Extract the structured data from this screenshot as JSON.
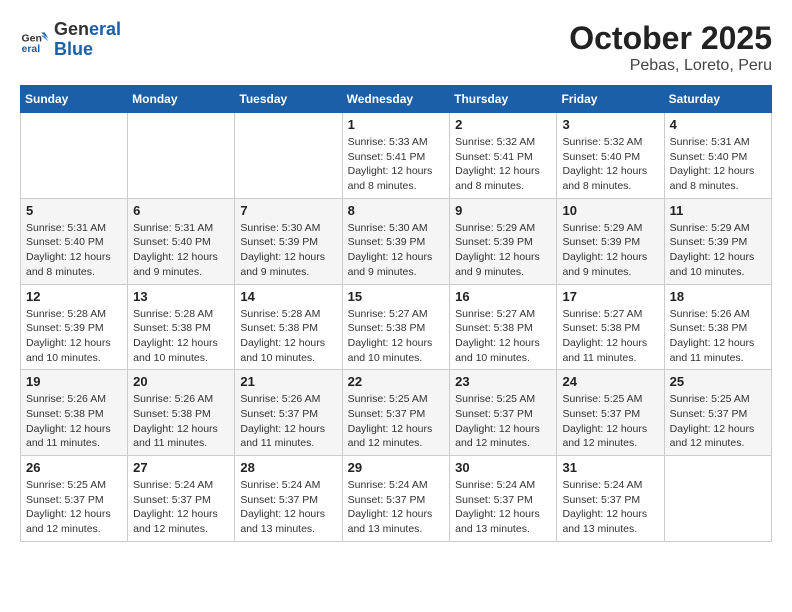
{
  "logo": {
    "line1": "General",
    "line2": "Blue"
  },
  "title": "October 2025",
  "subtitle": "Pebas, Loreto, Peru",
  "days_header": [
    "Sunday",
    "Monday",
    "Tuesday",
    "Wednesday",
    "Thursday",
    "Friday",
    "Saturday"
  ],
  "weeks": [
    [
      {
        "day": "",
        "info": ""
      },
      {
        "day": "",
        "info": ""
      },
      {
        "day": "",
        "info": ""
      },
      {
        "day": "1",
        "info": "Sunrise: 5:33 AM\nSunset: 5:41 PM\nDaylight: 12 hours and 8 minutes."
      },
      {
        "day": "2",
        "info": "Sunrise: 5:32 AM\nSunset: 5:41 PM\nDaylight: 12 hours and 8 minutes."
      },
      {
        "day": "3",
        "info": "Sunrise: 5:32 AM\nSunset: 5:40 PM\nDaylight: 12 hours and 8 minutes."
      },
      {
        "day": "4",
        "info": "Sunrise: 5:31 AM\nSunset: 5:40 PM\nDaylight: 12 hours and 8 minutes."
      }
    ],
    [
      {
        "day": "5",
        "info": "Sunrise: 5:31 AM\nSunset: 5:40 PM\nDaylight: 12 hours and 8 minutes."
      },
      {
        "day": "6",
        "info": "Sunrise: 5:31 AM\nSunset: 5:40 PM\nDaylight: 12 hours and 9 minutes."
      },
      {
        "day": "7",
        "info": "Sunrise: 5:30 AM\nSunset: 5:39 PM\nDaylight: 12 hours and 9 minutes."
      },
      {
        "day": "8",
        "info": "Sunrise: 5:30 AM\nSunset: 5:39 PM\nDaylight: 12 hours and 9 minutes."
      },
      {
        "day": "9",
        "info": "Sunrise: 5:29 AM\nSunset: 5:39 PM\nDaylight: 12 hours and 9 minutes."
      },
      {
        "day": "10",
        "info": "Sunrise: 5:29 AM\nSunset: 5:39 PM\nDaylight: 12 hours and 9 minutes."
      },
      {
        "day": "11",
        "info": "Sunrise: 5:29 AM\nSunset: 5:39 PM\nDaylight: 12 hours and 10 minutes."
      }
    ],
    [
      {
        "day": "12",
        "info": "Sunrise: 5:28 AM\nSunset: 5:39 PM\nDaylight: 12 hours and 10 minutes."
      },
      {
        "day": "13",
        "info": "Sunrise: 5:28 AM\nSunset: 5:38 PM\nDaylight: 12 hours and 10 minutes."
      },
      {
        "day": "14",
        "info": "Sunrise: 5:28 AM\nSunset: 5:38 PM\nDaylight: 12 hours and 10 minutes."
      },
      {
        "day": "15",
        "info": "Sunrise: 5:27 AM\nSunset: 5:38 PM\nDaylight: 12 hours and 10 minutes."
      },
      {
        "day": "16",
        "info": "Sunrise: 5:27 AM\nSunset: 5:38 PM\nDaylight: 12 hours and 10 minutes."
      },
      {
        "day": "17",
        "info": "Sunrise: 5:27 AM\nSunset: 5:38 PM\nDaylight: 12 hours and 11 minutes."
      },
      {
        "day": "18",
        "info": "Sunrise: 5:26 AM\nSunset: 5:38 PM\nDaylight: 12 hours and 11 minutes."
      }
    ],
    [
      {
        "day": "19",
        "info": "Sunrise: 5:26 AM\nSunset: 5:38 PM\nDaylight: 12 hours and 11 minutes."
      },
      {
        "day": "20",
        "info": "Sunrise: 5:26 AM\nSunset: 5:38 PM\nDaylight: 12 hours and 11 minutes."
      },
      {
        "day": "21",
        "info": "Sunrise: 5:26 AM\nSunset: 5:37 PM\nDaylight: 12 hours and 11 minutes."
      },
      {
        "day": "22",
        "info": "Sunrise: 5:25 AM\nSunset: 5:37 PM\nDaylight: 12 hours and 12 minutes."
      },
      {
        "day": "23",
        "info": "Sunrise: 5:25 AM\nSunset: 5:37 PM\nDaylight: 12 hours and 12 minutes."
      },
      {
        "day": "24",
        "info": "Sunrise: 5:25 AM\nSunset: 5:37 PM\nDaylight: 12 hours and 12 minutes."
      },
      {
        "day": "25",
        "info": "Sunrise: 5:25 AM\nSunset: 5:37 PM\nDaylight: 12 hours and 12 minutes."
      }
    ],
    [
      {
        "day": "26",
        "info": "Sunrise: 5:25 AM\nSunset: 5:37 PM\nDaylight: 12 hours and 12 minutes."
      },
      {
        "day": "27",
        "info": "Sunrise: 5:24 AM\nSunset: 5:37 PM\nDaylight: 12 hours and 12 minutes."
      },
      {
        "day": "28",
        "info": "Sunrise: 5:24 AM\nSunset: 5:37 PM\nDaylight: 12 hours and 13 minutes."
      },
      {
        "day": "29",
        "info": "Sunrise: 5:24 AM\nSunset: 5:37 PM\nDaylight: 12 hours and 13 minutes."
      },
      {
        "day": "30",
        "info": "Sunrise: 5:24 AM\nSunset: 5:37 PM\nDaylight: 12 hours and 13 minutes."
      },
      {
        "day": "31",
        "info": "Sunrise: 5:24 AM\nSunset: 5:37 PM\nDaylight: 12 hours and 13 minutes."
      },
      {
        "day": "",
        "info": ""
      }
    ]
  ]
}
